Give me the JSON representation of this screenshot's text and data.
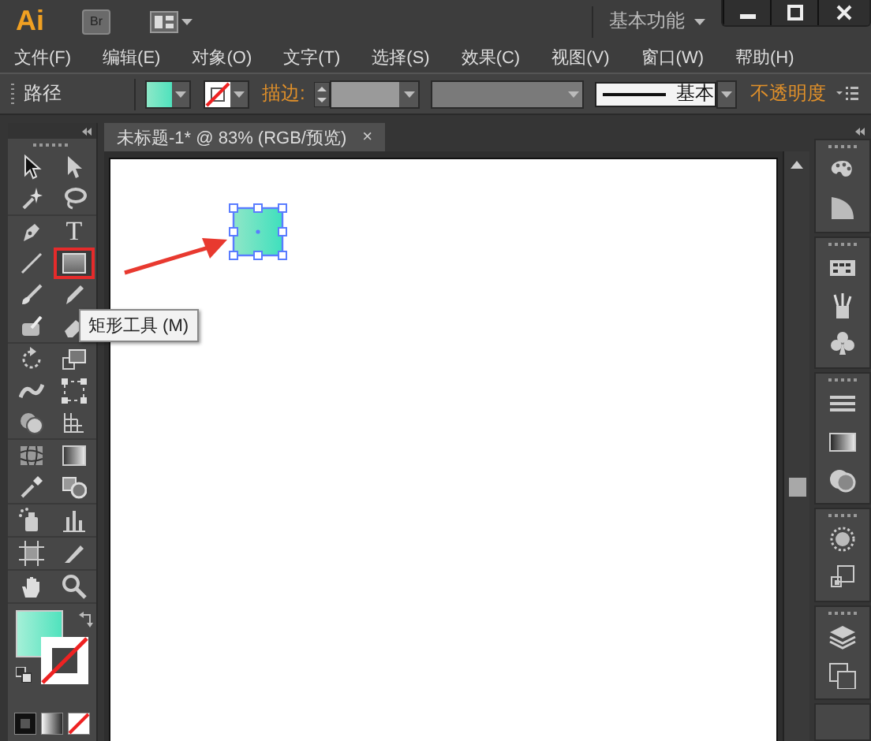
{
  "title_bar": {
    "logo": "Ai",
    "bridge_label": "Br",
    "workspace": "基本功能"
  },
  "menu": [
    "文件(F)",
    "编辑(E)",
    "对象(O)",
    "文字(T)",
    "选择(S)",
    "效果(C)",
    "视图(V)",
    "窗口(W)",
    "帮助(H)"
  ],
  "control_bar": {
    "selection": "路径",
    "stroke_label": "描边:",
    "stroke_style": "基本",
    "opacity_label": "不透明度"
  },
  "tool_groups": [
    {
      "tools": [
        {
          "kind": "select",
          "selected": false
        },
        {
          "kind": "direct-select",
          "selected": false
        },
        {
          "kind": "magic-wand",
          "selected": false
        },
        {
          "kind": "lasso",
          "selected": false
        }
      ]
    },
    {
      "tools": [
        {
          "kind": "pen",
          "selected": false
        },
        {
          "kind": "type",
          "glyph": "T",
          "selected": false
        },
        {
          "kind": "line",
          "selected": false
        },
        {
          "kind": "rectangle",
          "selected": true
        },
        {
          "kind": "paintbrush",
          "selected": false
        },
        {
          "kind": "pencil",
          "selected": false
        },
        {
          "kind": "blob-brush",
          "selected": false
        },
        {
          "kind": "eraser",
          "selected": false
        }
      ]
    },
    {
      "tools": [
        {
          "kind": "rotate",
          "selected": false
        },
        {
          "kind": "scale",
          "selected": false
        },
        {
          "kind": "warp",
          "selected": false
        },
        {
          "kind": "free-transform",
          "selected": false
        },
        {
          "kind": "shape-builder",
          "selected": false
        },
        {
          "kind": "perspective-grid",
          "selected": false
        }
      ]
    },
    {
      "tools": [
        {
          "kind": "mesh",
          "selected": false
        },
        {
          "kind": "gradient",
          "selected": false
        },
        {
          "kind": "eyedropper",
          "selected": false
        },
        {
          "kind": "blend",
          "selected": false
        }
      ]
    },
    {
      "tools": [
        {
          "kind": "symbol-sprayer",
          "selected": false
        },
        {
          "kind": "column-graph",
          "selected": false
        }
      ]
    },
    {
      "tools": [
        {
          "kind": "artboard",
          "selected": false
        },
        {
          "kind": "slice",
          "selected": false
        }
      ]
    },
    {
      "tools": [
        {
          "kind": "hand",
          "selected": false
        },
        {
          "kind": "zoom",
          "selected": false
        }
      ]
    }
  ],
  "tooltip": "矩形工具 (M)",
  "document_tab": {
    "title": "未标题-1* @ 83% (RGB/预览)",
    "close": "×"
  },
  "canvas": {
    "shape": {
      "selected": true
    }
  }
}
